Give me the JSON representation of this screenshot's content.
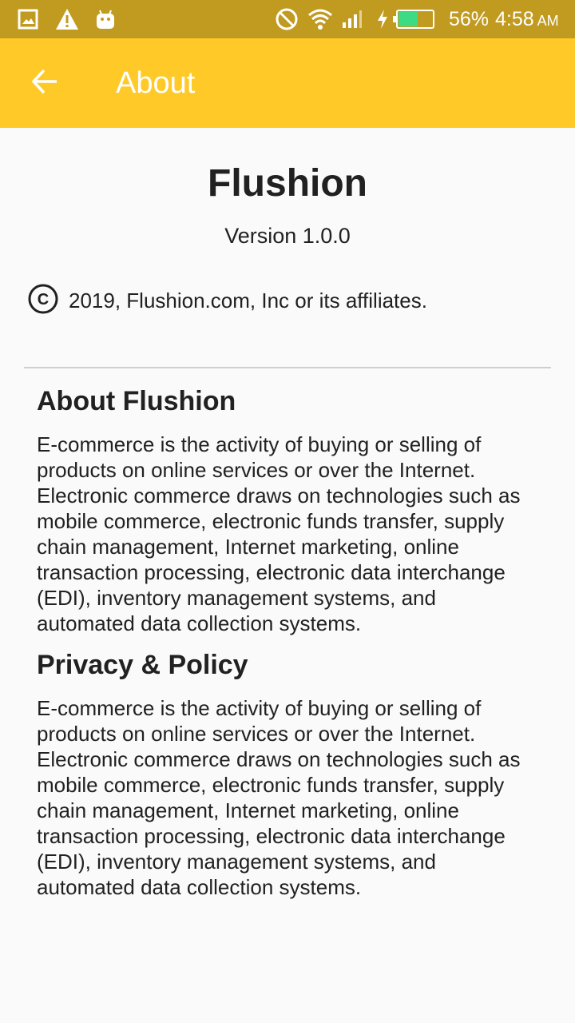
{
  "status_bar": {
    "battery_percent": "56%",
    "time": "4:58",
    "ampm": "AM",
    "battery_level": 0.56,
    "icons": [
      "image-icon",
      "warning-icon",
      "android-icon",
      "do-not-disturb-icon",
      "wifi-icon",
      "signal-icon",
      "charging-icon",
      "battery-icon"
    ]
  },
  "app_bar": {
    "title": "About"
  },
  "about": {
    "app_name": "Flushion",
    "version": "Version 1.0.0",
    "copyright_symbol": "C",
    "copyright": "2019, Flushion.com, Inc or its affiliates."
  },
  "sections": [
    {
      "heading": "About Flushion",
      "body": "E-commerce is the activity of buying or selling of products on online services or over the Internet. Electronic commerce draws on technologies such as mobile commerce, electronic funds transfer, supply chain management, Internet marketing, online transaction processing, electronic data interchange (EDI), inventory management systems, and automated data collection systems."
    },
    {
      "heading": "Privacy & Policy",
      "body": "E-commerce is the activity of buying or selling of products on online services or over the Internet. Electronic commerce draws on technologies such as mobile commerce, electronic funds transfer, supply chain management, Internet marketing, online transaction processing, electronic data interchange (EDI), inventory management systems, and automated data collection systems."
    }
  ],
  "colors": {
    "status_bar": "#c19a20",
    "app_bar": "#ffca28",
    "battery_fill": "#3ddc84",
    "text": "#212121"
  }
}
